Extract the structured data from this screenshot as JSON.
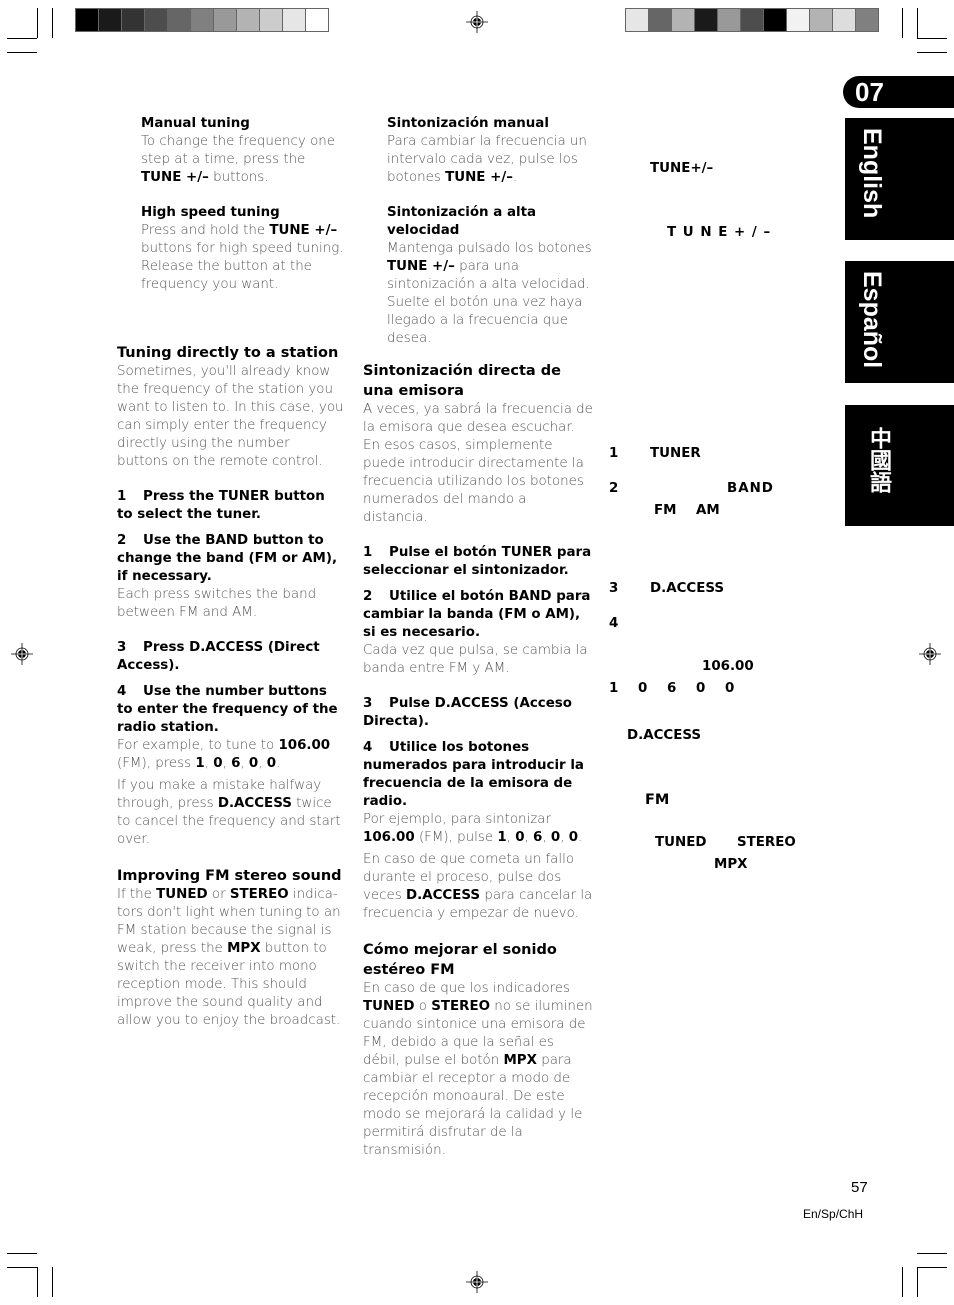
{
  "print_marks": {
    "left_color_bar": [
      "#000000",
      "#1a1a1a",
      "#333333",
      "#4d4d4d",
      "#666666",
      "#808080",
      "#999999",
      "#b3b3b3",
      "#cccccc",
      "#e6e6e6",
      "#ffffff"
    ],
    "right_color_bar": [
      "#e6e6e6",
      "#666666",
      "#b3b3b3",
      "#1a1a1a",
      "#999999",
      "#4d4d4d",
      "#000000",
      "#f2f2f2",
      "#b3b3b3",
      "#dddddd",
      "#808080"
    ]
  },
  "side_tabs": {
    "chapter": "07",
    "english": "English",
    "espanol": "Español",
    "chinese": "中國語"
  },
  "english": {
    "manual_tuning": {
      "title": "Manual tuning",
      "text_1": "To change the frequency one step at a time, press the ",
      "bold_1": "TUNE +/–",
      "text_2": " buttons."
    },
    "high_speed": {
      "title": "High speed tuning",
      "text_1": "Press and hold the ",
      "bold_1": "TUNE +/–",
      "text_2": " buttons for high speed tuning. Release the button at the frequency you want."
    },
    "direct": {
      "title": "Tuning directly to a station",
      "intro": "Sometimes, you'll already know the frequency of the station you want to listen to. In this case, you can simply enter the frequency directly using the number buttons on the remote control.",
      "steps": [
        {
          "num": "1",
          "text": "Press the TUNER button to select the tuner."
        },
        {
          "num": "2",
          "text": "Use the BAND button to change the band (FM or AM), if necessary."
        },
        {
          "num": "3",
          "text": "Press D.ACCESS (Direct Access)."
        },
        {
          "num": "4",
          "text": "Use the number buttons to enter the frequency of the radio station."
        }
      ],
      "step2_note": "Each press switches the band between FM and AM.",
      "example_text_1": "For example, to tune to ",
      "example_freq": "106.00",
      "example_text_2": " (FM), press ",
      "digits": [
        "1",
        "0",
        "6",
        "0",
        "0"
      ],
      "mistake_text_1": "If you make a mistake halfway through, press ",
      "mistake_bold": "D.ACCESS",
      "mistake_text_2": " twice to cancel the frequency and start over."
    },
    "fm_stereo": {
      "title": "Improving FM stereo sound",
      "t1": "If the ",
      "b1": "TUNED",
      "t2": " or ",
      "b2": "STEREO",
      "t3": " indica-tors don't light when tuning to an FM station because the signal is weak, press the ",
      "b3": "MPX",
      "t4": " button to switch the receiver into mono reception mode. This should improve the sound quality and allow you to enjoy the broadcast."
    }
  },
  "spanish": {
    "manual_tuning": {
      "title": "Sintonización manual",
      "text_1": "Para cambiar la frecuencia un intervalo cada vez, pulse los botones ",
      "bold_1": "TUNE +/–",
      "text_2": "."
    },
    "high_speed": {
      "title": "Sintonización a alta velocidad",
      "text_1": "Mantenga pulsado los botones ",
      "bold_1": "TUNE +/–",
      "text_2": " para una sintonización a alta velocidad. Suelte el botón una vez haya llegado a la frecuencia que desea."
    },
    "direct": {
      "title": "Sintonización directa de una emisora",
      "intro": "A veces, ya sabrá la frecuencia de la emisora que desea escuchar. En esos casos, simplemente puede introducir directamente la frecuencia utilizando los botones numerados del mando a distancia.",
      "steps": [
        {
          "num": "1",
          "text": "Pulse el botón TUNER para seleccionar el sintonizador."
        },
        {
          "num": "2",
          "text": "Utilice el botón BAND para cambiar la banda (FM o AM), si es necesario."
        },
        {
          "num": "3",
          "text": "Pulse D.ACCESS (Acceso Directa)."
        },
        {
          "num": "4",
          "text": "Utilice los botones numerados para introducir la frecuencia de la emisora de radio."
        }
      ],
      "step2_note": "Cada vez que pulsa, se cambia la banda entre FM y AM.",
      "example_text_1": "Por ejemplo, para sintonizar ",
      "example_freq": "106.00",
      "example_text_2": " (FM), pulse ",
      "digits": [
        "1",
        "0",
        "6",
        "0",
        "0"
      ],
      "mistake_text_1": "En caso de que cometa un fallo durante el proceso, pulse dos veces ",
      "mistake_bold": "D.ACCESS",
      "mistake_text_2": " para cancelar la frecuencia y empezar de nuevo."
    },
    "fm_stereo": {
      "title": "Cómo mejorar el sonido estéreo FM",
      "t1": "En caso de que los indicadores ",
      "b1": "TUNED",
      "t2": " o ",
      "b2": "STEREO",
      "t3": " no se iluminen cuando sintonice una emisora de FM, debido a que la señal es débil, pulse el botón ",
      "b3": "MPX",
      "t4": " para cambiar el receptor a modo de recepción monoaural. De este modo se mejorará la calidad y le permitirá disfrutar de la transmisión."
    }
  },
  "chinese_visible": {
    "tune_1": "TUNE+/–",
    "tune_2": "T U N E + / –",
    "step1_num": "1",
    "step1_key": "TUNER",
    "step2_num": "2",
    "step2_key": "BAND",
    "fm": "FM",
    "am": "AM",
    "step3_num": "3",
    "step3_key": "D.ACCESS",
    "step4_num": "4",
    "freq": "106.00",
    "digits": [
      "1",
      "0",
      "6",
      "0",
      "0"
    ],
    "daccess": "D.ACCESS",
    "fm2": "FM",
    "tuned": "TUNED",
    "stereo": "STEREO",
    "mpx": "MPX"
  },
  "footer": {
    "page_number": "57",
    "code": "En/Sp/ChH"
  }
}
